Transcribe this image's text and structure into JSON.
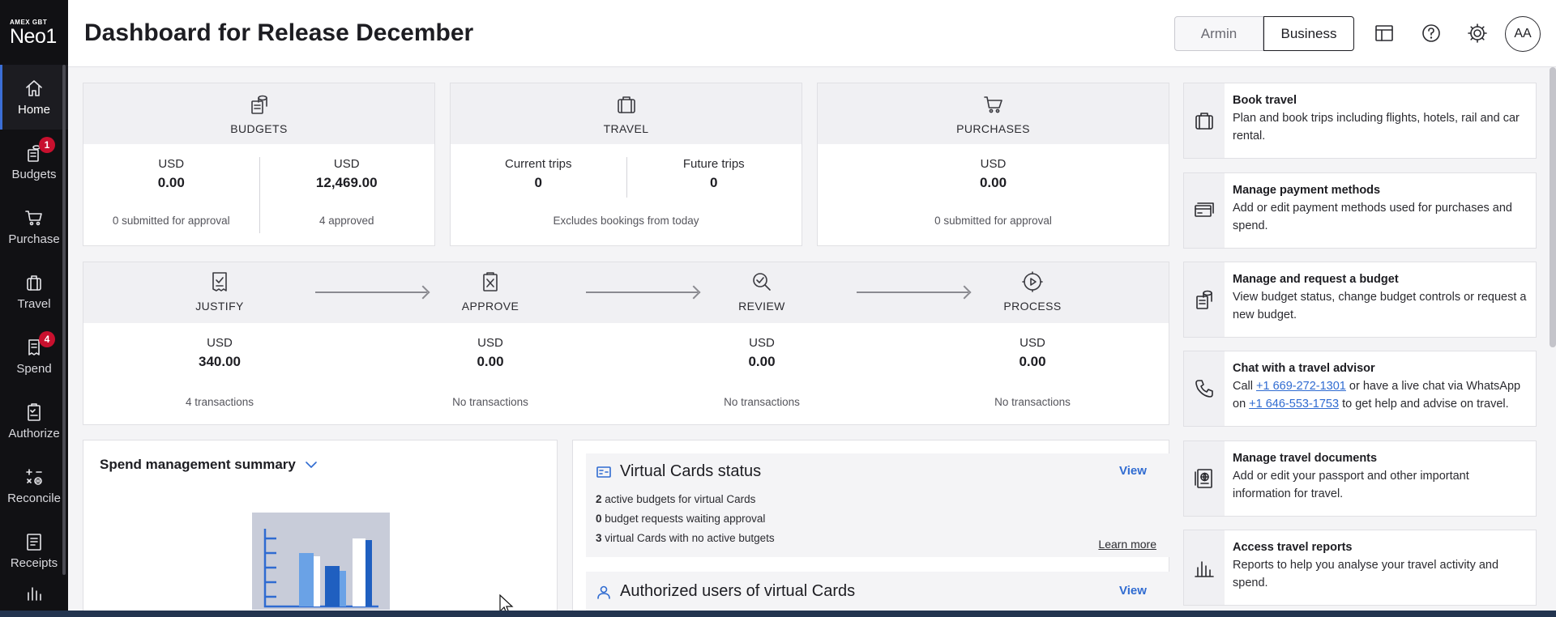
{
  "brand": {
    "small": "AMEX GBT",
    "big": "Neo1"
  },
  "sidebar": {
    "items": [
      {
        "label": "Home",
        "icon": "home-icon",
        "badge": ""
      },
      {
        "label": "Budgets",
        "icon": "budget-icon",
        "badge": "1"
      },
      {
        "label": "Purchase",
        "icon": "cart-icon",
        "badge": ""
      },
      {
        "label": "Travel",
        "icon": "suitcase-icon",
        "badge": ""
      },
      {
        "label": "Spend",
        "icon": "receipt-icon",
        "badge": "4"
      },
      {
        "label": "Authorize",
        "icon": "clipboard-icon",
        "badge": ""
      },
      {
        "label": "Reconcile",
        "icon": "calculator-icon",
        "badge": ""
      },
      {
        "label": "Receipts",
        "icon": "receipts-icon",
        "badge": ""
      }
    ]
  },
  "header": {
    "title": "Dashboard for Release December",
    "toggle_left": "Armin",
    "toggle_right": "Business",
    "avatar": "AA"
  },
  "budgets": {
    "heading": "BUDGETS",
    "col1": {
      "label": "USD",
      "value": "0.00",
      "sub": "0 submitted for approval"
    },
    "col2": {
      "label": "USD",
      "value": "12,469.00",
      "sub": "4 approved"
    }
  },
  "travel": {
    "heading": "TRAVEL",
    "col1": {
      "label": "Current trips",
      "value": "0"
    },
    "col2": {
      "label": "Future trips",
      "value": "0"
    },
    "note": "Excludes bookings from today"
  },
  "purchases": {
    "heading": "PURCHASES",
    "label": "USD",
    "value": "0.00",
    "sub": "0 submitted for approval"
  },
  "flow": {
    "steps": [
      {
        "heading": "JUSTIFY",
        "label": "USD",
        "value": "340.00",
        "sub": "4 transactions"
      },
      {
        "heading": "APPROVE",
        "label": "USD",
        "value": "0.00",
        "sub": "No transactions"
      },
      {
        "heading": "REVIEW",
        "label": "USD",
        "value": "0.00",
        "sub": "No transactions"
      },
      {
        "heading": "PROCESS",
        "label": "USD",
        "value": "0.00",
        "sub": "No transactions"
      }
    ]
  },
  "summary": {
    "title": "Spend management summary"
  },
  "virtual_cards": {
    "title": "Virtual Cards status",
    "view": "View",
    "lines": [
      {
        "count": "2",
        "text": "active budgets for virtual Cards"
      },
      {
        "count": "0",
        "text": "budget requests waiting approval"
      },
      {
        "count": "3",
        "text": "virtual Cards with no active butgets"
      }
    ],
    "learn_more": "Learn more",
    "authorized_title": "Authorized users of virtual Cards",
    "authorized_view": "View"
  },
  "actions": [
    {
      "title": "Book travel",
      "desc": "Plan and book trips including flights, hotels, rail and car rental."
    },
    {
      "title": "Manage payment methods",
      "desc": "Add or edit payment methods used for purchases and spend."
    },
    {
      "title": "Manage and request a budget",
      "desc": "View budget status, change budget controls or request a new budget."
    },
    {
      "title": "Chat with a travel advisor",
      "desc_pre": "Call ",
      "phone1": "+1 669-272-1301",
      "desc_mid": " or have a live chat via WhatsApp on ",
      "phone2": "+1 646-553-1753",
      "desc_post": " to get help and advise on travel."
    },
    {
      "title": "Manage travel documents",
      "desc": "Add or edit your passport and other important information for travel."
    },
    {
      "title": "Access travel reports",
      "desc": "Reports to help you analyse your travel activity and spend."
    }
  ],
  "colors": {
    "accent": "#2f6bd1",
    "sidebar": "#111114",
    "badge": "#c8102e"
  }
}
